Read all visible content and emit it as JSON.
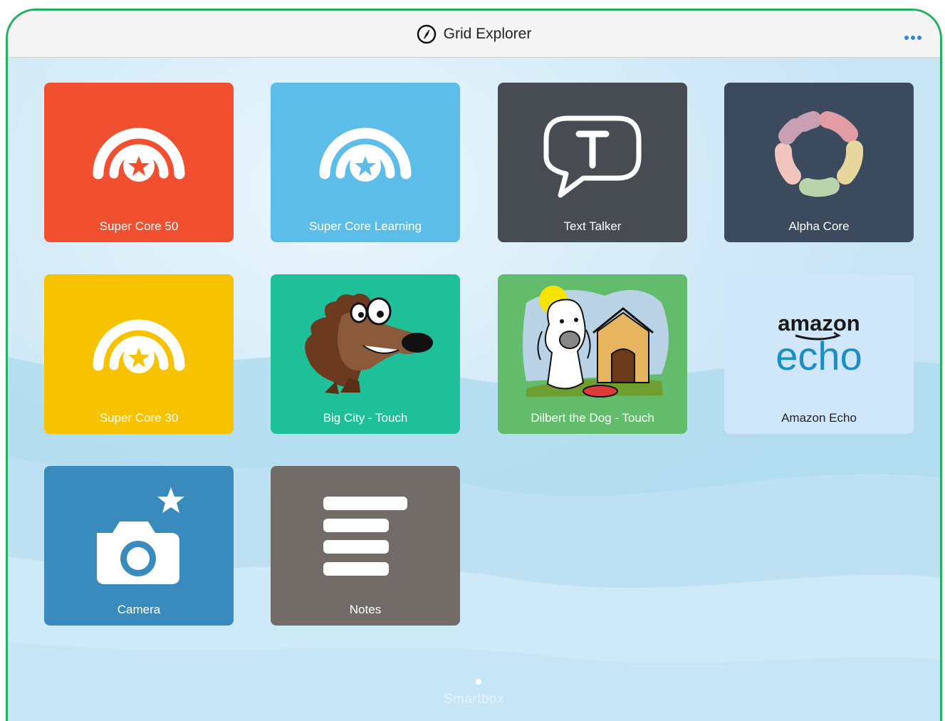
{
  "header": {
    "title": "Grid Explorer",
    "icon": "compass-icon",
    "more_icon": "more-icon"
  },
  "tiles": [
    {
      "label": "Super Core 50",
      "color": "#f05030",
      "icon": "super-core-icon"
    },
    {
      "label": "Super Core Learning",
      "color": "#5bbde8",
      "icon": "super-core-icon"
    },
    {
      "label": "Text Talker",
      "color": "#474b52",
      "icon": "speech-bubble-icon"
    },
    {
      "label": "Alpha Core",
      "color": "#3b4a5c",
      "icon": "ring-icon"
    },
    {
      "label": "Super Core 30",
      "color": "#f7c200",
      "icon": "super-core-icon"
    },
    {
      "label": "Big City - Touch",
      "color": "#1fbf9a",
      "icon": "hedgehog-icon"
    },
    {
      "label": "Dilbert the Dog - Touch",
      "color": "#63bc6c",
      "icon": "dog-icon"
    },
    {
      "label": "Amazon Echo",
      "color": "#cfe6fb",
      "icon": "amazon-echo-logo",
      "logo_text": {
        "top": "amazon",
        "bottom": "echo"
      }
    },
    {
      "label": "Camera",
      "color": "#3a8bbd",
      "icon": "camera-icon"
    },
    {
      "label": "Notes",
      "color": "#726b68",
      "icon": "notes-icon"
    }
  ],
  "footer": {
    "brand": "Smartbox",
    "page_indicator": "1"
  }
}
